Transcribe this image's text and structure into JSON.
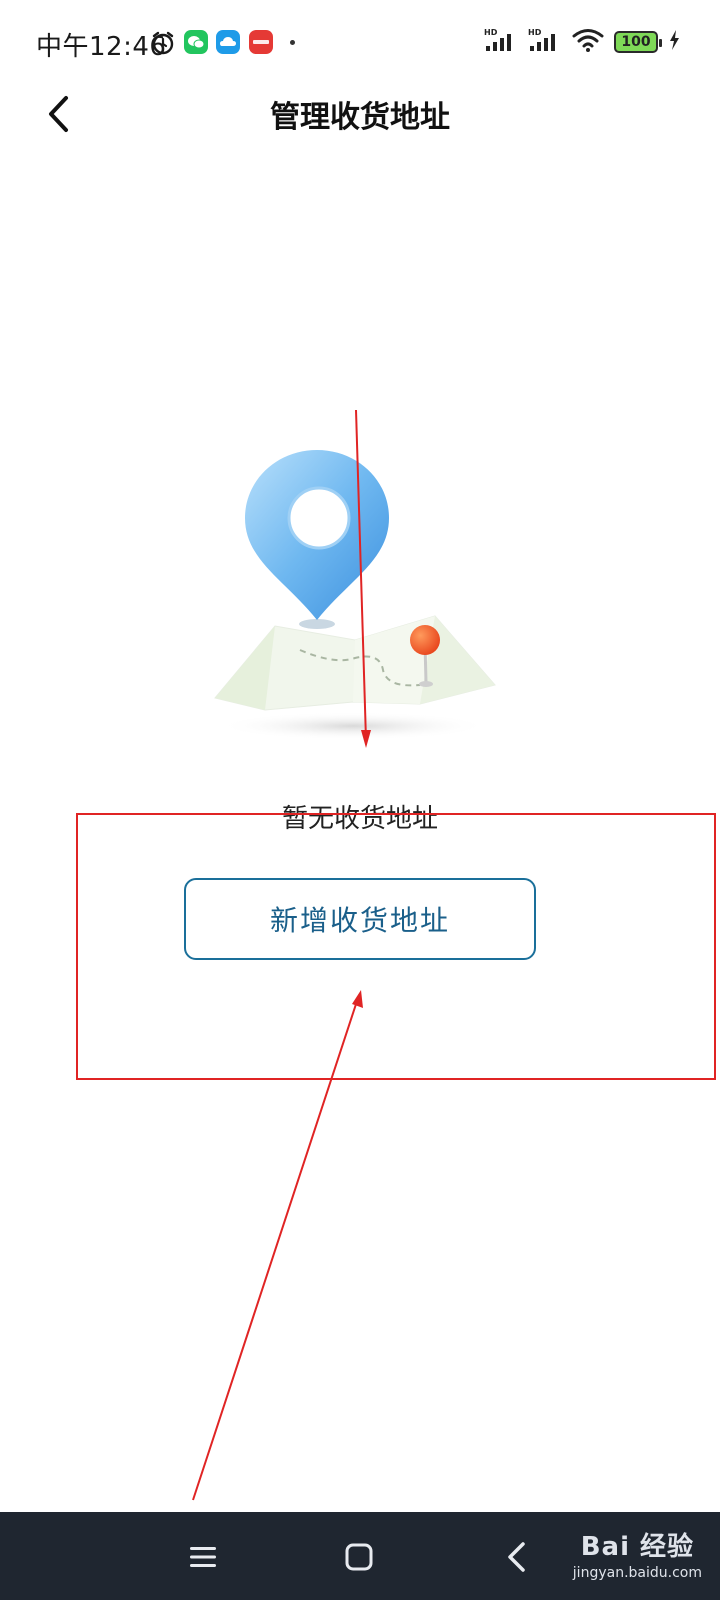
{
  "status_bar": {
    "time": "中午12:46",
    "battery": "100",
    "app_icons": [
      "alarm-icon",
      "wechat-icon",
      "cloud-icon",
      "xiaohongshu-icon"
    ],
    "colors": {
      "wechat": "#22c55e",
      "cloud": "#1e9be8",
      "xiaohongshu": "#e53935",
      "battery_fill": "#7ed957"
    }
  },
  "header": {
    "title": "管理收货地址",
    "back_icon": "chevron-left-icon"
  },
  "empty_state": {
    "illustration": "map-location-pin-illustration",
    "message": "暂无收货地址",
    "add_button_label": "新增收货地址"
  },
  "navigation_bar": {
    "menu_icon": "menu-icon",
    "home_icon": "home-square-icon",
    "back_icon": "back-arrow-icon"
  },
  "watermark": {
    "brand": "Bai 经验",
    "url": "jingyan.baidu.com"
  },
  "colors": {
    "accent": "#1a6f9a",
    "annotation": "#e02424",
    "nav_background": "#1f2630"
  }
}
